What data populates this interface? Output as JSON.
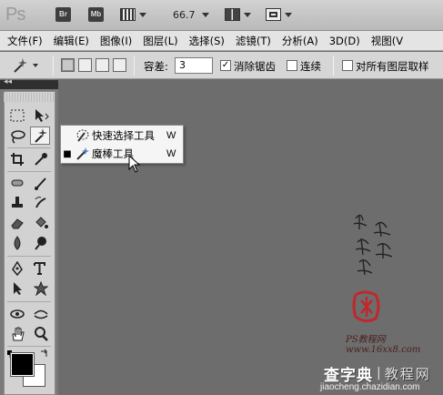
{
  "app": {
    "logo": "Ps",
    "bridge_label": "Br",
    "minibridge_label": "Mb",
    "zoom_level": "66.7"
  },
  "menubar": {
    "items": [
      "文件(F)",
      "编辑(E)",
      "图像(I)",
      "图层(L)",
      "选择(S)",
      "滤镜(T)",
      "分析(A)",
      "3D(D)",
      "视图(V"
    ]
  },
  "options": {
    "tolerance_label": "容差:",
    "tolerance_value": "3",
    "antialias_label": "消除锯齿",
    "antialias_checked": true,
    "contiguous_label": "连续",
    "contiguous_checked": false,
    "sample_all_label": "对所有图层取样",
    "sample_all_checked": false
  },
  "panel": {
    "collapse_label": "◂◂"
  },
  "flyout": {
    "items": [
      {
        "label": "快速选择工具",
        "shortcut": "W",
        "selected": false,
        "icon": "quick-selection-icon"
      },
      {
        "label": "魔棒工具",
        "shortcut": "W",
        "selected": true,
        "icon": "magic-wand-icon"
      }
    ]
  },
  "watermark": {
    "url": "PS教程网 www.16xx8.com",
    "brand": "查字典",
    "sub": "教程网",
    "domain": "jiaocheng.chazidian.com"
  },
  "colors": {
    "canvas": "#6d6d6d",
    "foreground": "#000000",
    "background": "#ffffff"
  }
}
